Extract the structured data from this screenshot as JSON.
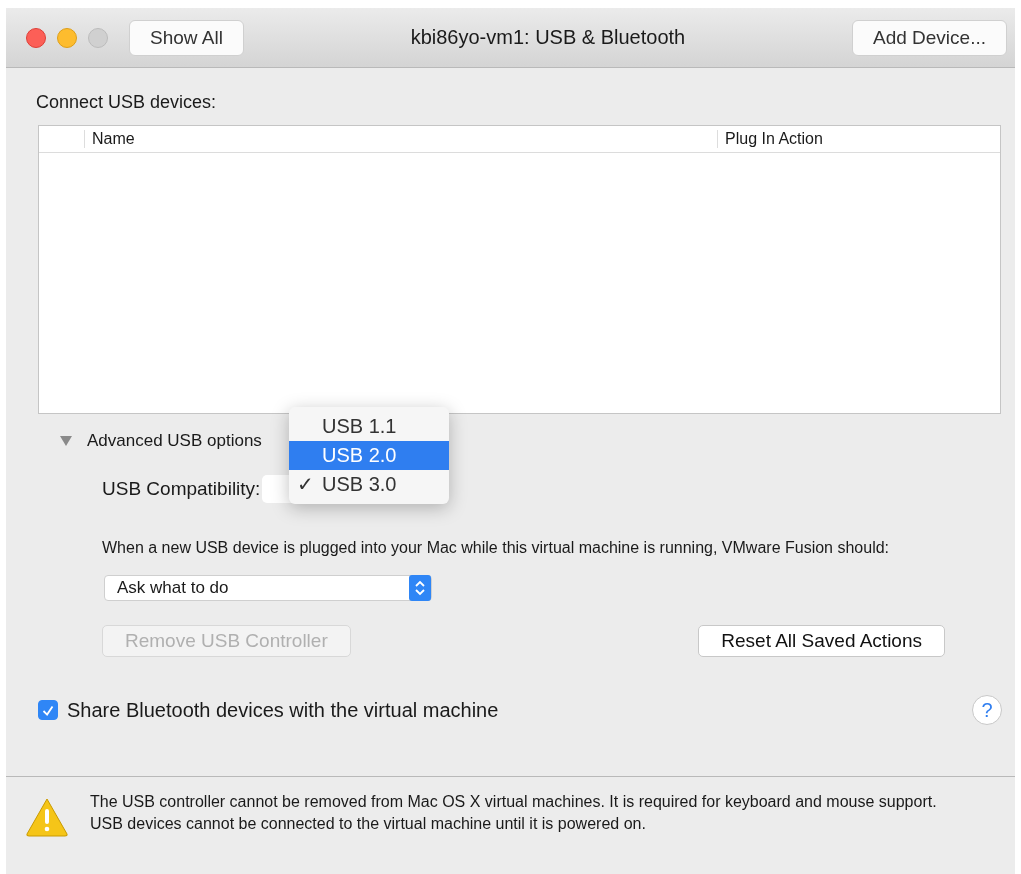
{
  "window": {
    "title": "kbi86yo-vm1: USB & Bluetooth",
    "show_all": "Show All",
    "add_device": "Add Device..."
  },
  "devices": {
    "label": "Connect USB devices:",
    "columns": [
      "Name",
      "Plug In Action"
    ]
  },
  "advanced": {
    "label": "Advanced USB options",
    "expanded": true
  },
  "compatibility": {
    "label": "USB Compatibility:",
    "menu": [
      {
        "label": "USB 1.1",
        "selected": false,
        "checked": false
      },
      {
        "label": "USB 2.0",
        "selected": true,
        "checked": false
      },
      {
        "label": "USB 3.0",
        "selected": false,
        "checked": true
      }
    ],
    "check": "✓"
  },
  "plug_in": {
    "text": "When a new USB device is plugged into your Mac while this virtual machine is running, VMware Fusion should:",
    "value": "Ask what to do"
  },
  "buttons": [
    {
      "label": "Remove USB Controller",
      "disabled": true
    },
    {
      "label": "Reset All Saved Actions",
      "disabled": false
    }
  ],
  "bluetooth": {
    "label": "Share Bluetooth devices with the virtual machine",
    "checked": true
  },
  "help": "?",
  "footer": {
    "lines": [
      "The USB controller cannot be removed from Mac OS X virtual machines. It is required for keyboard and mouse support.",
      "USB devices cannot be connected to the virtual machine until it is powered on."
    ]
  }
}
